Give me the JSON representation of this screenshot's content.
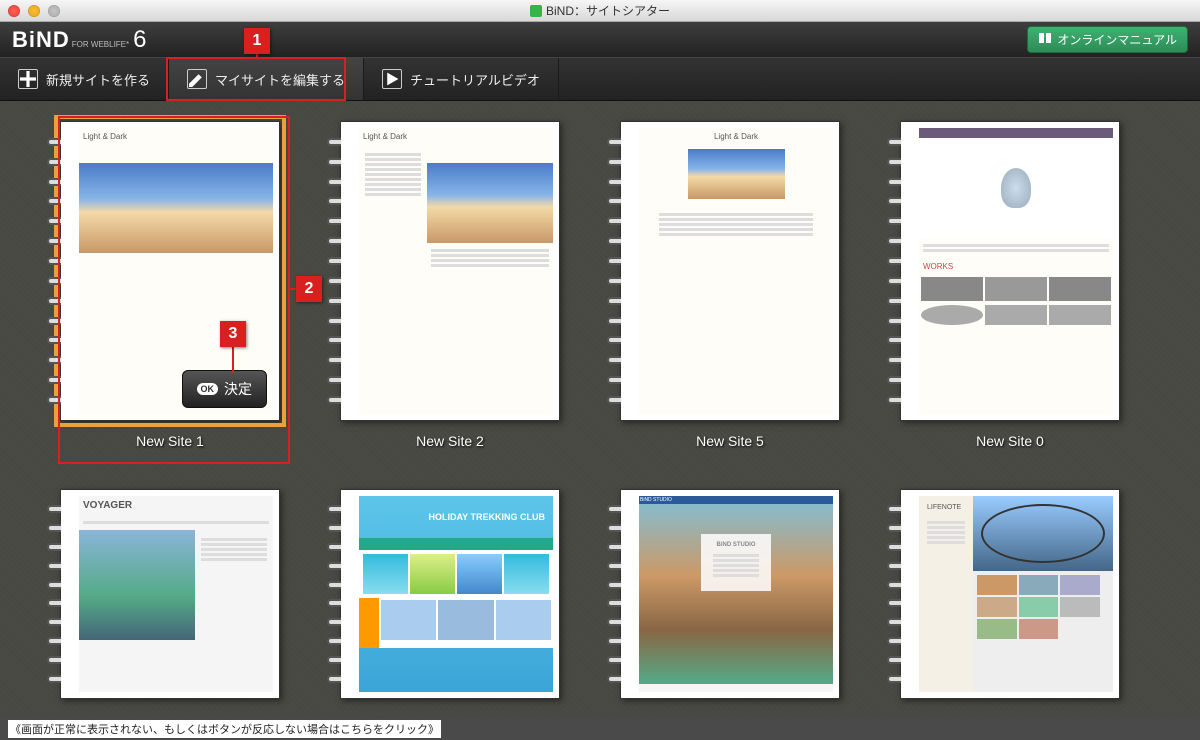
{
  "window": {
    "title": "BiND：サイトシアター"
  },
  "brand": {
    "name": "BiND",
    "tagline": "FOR WEBLIFE*",
    "version": "6"
  },
  "header": {
    "manual_button": "オンラインマニュアル"
  },
  "toolbar": {
    "new_site": "新規サイトを作る",
    "edit_my_site": "マイサイトを編集する",
    "tutorial_video": "チュートリアルビデオ"
  },
  "callouts": {
    "one": "1",
    "two": "2",
    "three": "3"
  },
  "ok_button": {
    "badge": "OK",
    "label": "決定"
  },
  "sites": [
    {
      "name": "New Site 1",
      "thumb_title": "Light & Dark"
    },
    {
      "name": "New Site 2",
      "thumb_title": "Light & Dark"
    },
    {
      "name": "New Site 5",
      "thumb_title": "Light & Dark"
    },
    {
      "name": "New Site 0",
      "thumb_title": "WORKS"
    },
    {
      "name": "",
      "thumb_title": "VOYAGER"
    },
    {
      "name": "",
      "thumb_title": "HOLIDAY TREKKING CLUB"
    },
    {
      "name": "",
      "thumb_title": "BiND STUDIO"
    },
    {
      "name": "",
      "thumb_title": "LIFENOTE"
    }
  ],
  "footnote": "《画面が正常に表示されない、もしくはボタンが反応しない場合はこちらをクリック》"
}
